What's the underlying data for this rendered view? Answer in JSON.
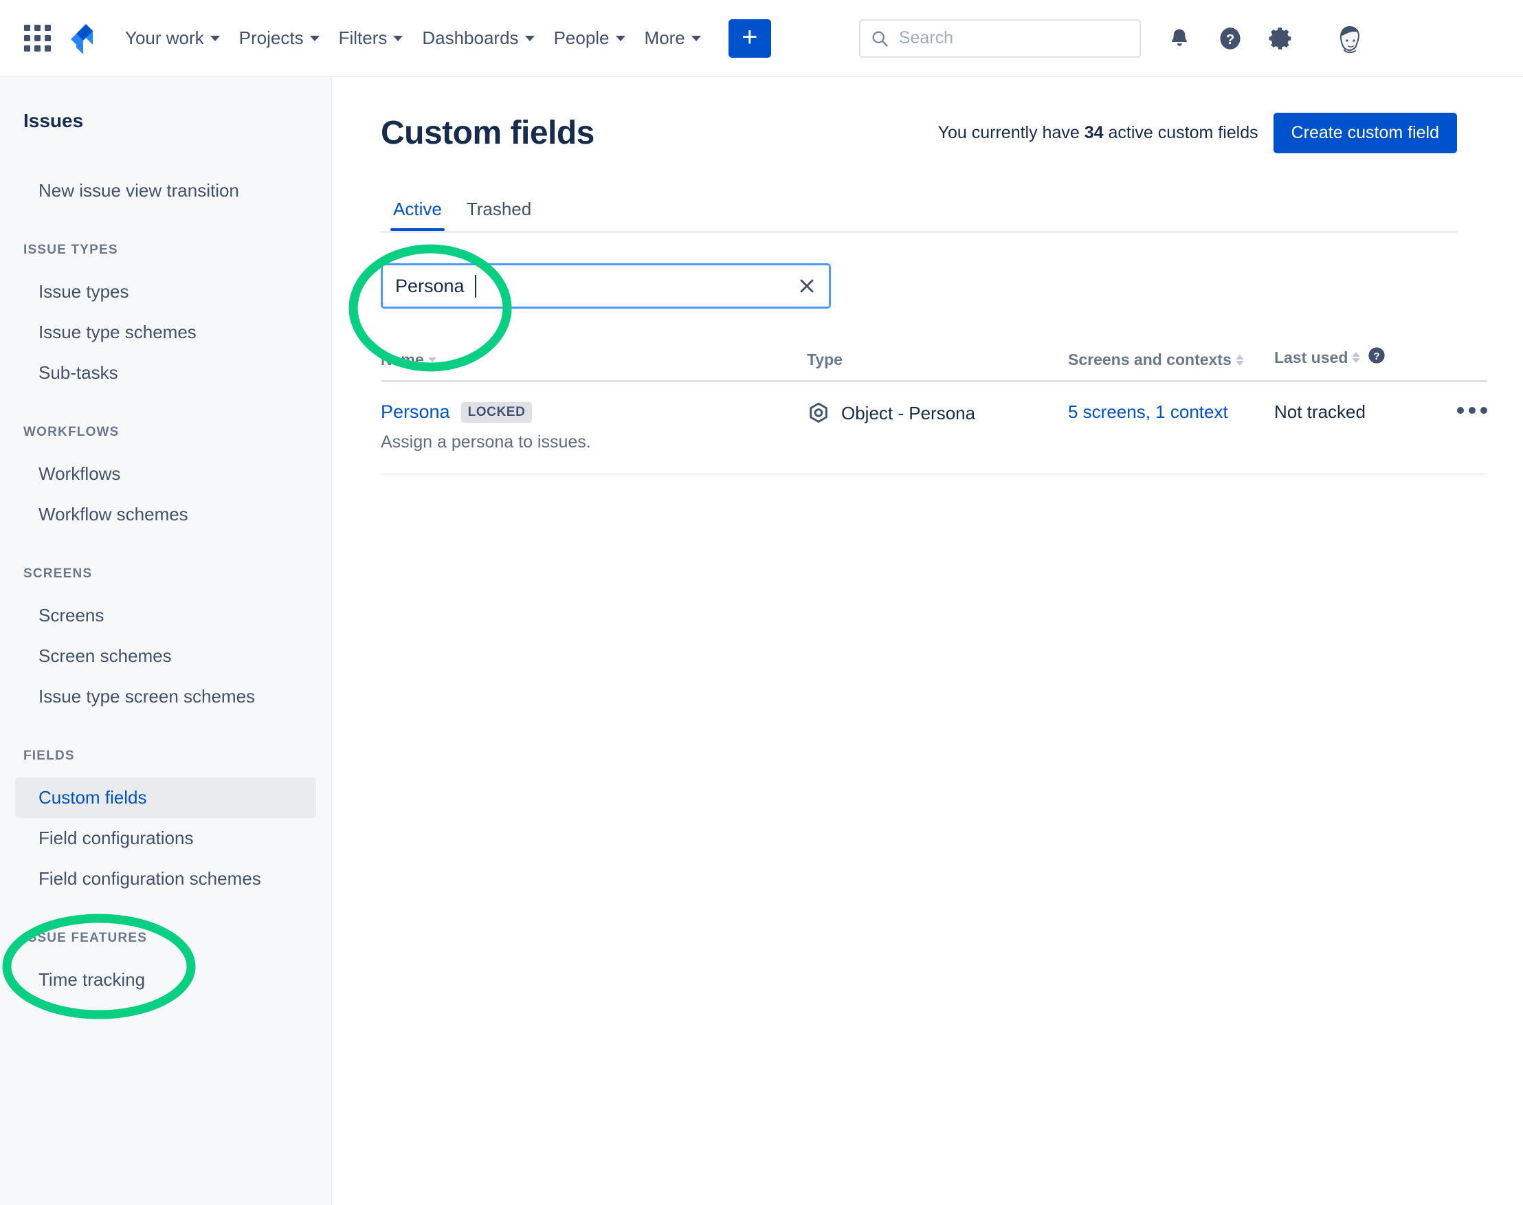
{
  "topnav": {
    "app_switcher_icon": "app-switcher-grid-icon",
    "logo_icon": "jira-logo",
    "items": [
      {
        "label": "Your work",
        "has_caret": true
      },
      {
        "label": "Projects",
        "has_caret": true
      },
      {
        "label": "Filters",
        "has_caret": true
      },
      {
        "label": "Dashboards",
        "has_caret": true
      },
      {
        "label": "People",
        "has_caret": true
      },
      {
        "label": "More",
        "has_caret": true
      }
    ],
    "create_button_label": "+",
    "search_placeholder": "Search",
    "search_value": "",
    "icons": [
      "notifications-bell-icon",
      "help-question-icon",
      "settings-gear-icon",
      "user-avatar"
    ]
  },
  "sidebar": {
    "title": "Issues",
    "groups": [
      {
        "section": null,
        "items": [
          {
            "label": "New issue view transition",
            "selected": false
          }
        ]
      },
      {
        "section": "ISSUE TYPES",
        "items": [
          {
            "label": "Issue types",
            "selected": false
          },
          {
            "label": "Issue type schemes",
            "selected": false
          },
          {
            "label": "Sub-tasks",
            "selected": false
          }
        ]
      },
      {
        "section": "WORKFLOWS",
        "items": [
          {
            "label": "Workflows",
            "selected": false
          },
          {
            "label": "Workflow schemes",
            "selected": false
          }
        ]
      },
      {
        "section": "SCREENS",
        "items": [
          {
            "label": "Screens",
            "selected": false
          },
          {
            "label": "Screen schemes",
            "selected": false
          },
          {
            "label": "Issue type screen schemes",
            "selected": false
          }
        ]
      },
      {
        "section": "FIELDS",
        "items": [
          {
            "label": "Custom fields",
            "selected": true
          },
          {
            "label": "Field configurations",
            "selected": false
          },
          {
            "label": "Field configuration schemes",
            "selected": false
          }
        ]
      },
      {
        "section": "ISSUE FEATURES",
        "items": [
          {
            "label": "Time tracking",
            "selected": false
          }
        ]
      }
    ]
  },
  "main": {
    "page_title": "Custom fields",
    "count_prefix": "You currently have ",
    "count_value": "34",
    "count_suffix": " active custom fields",
    "create_field_button": "Create custom field",
    "tabs": [
      {
        "label": "Active",
        "active": true
      },
      {
        "label": "Trashed",
        "active": false
      }
    ],
    "filter": {
      "value": "Persona",
      "placeholder": "",
      "clear_icon": "close-x-icon"
    },
    "table": {
      "columns": [
        {
          "label": "Name",
          "sortable": true
        },
        {
          "label": "Type",
          "sortable": false
        },
        {
          "label": "Screens and contexts",
          "sortable": true
        },
        {
          "label": "Last used",
          "sortable": true,
          "help": true
        },
        {
          "label": "",
          "sortable": false
        }
      ],
      "rows": [
        {
          "name": "Persona",
          "badge": "LOCKED",
          "description": "Assign a persona to issues.",
          "type_icon": "object-hexagon-icon",
          "type": "Object - Persona",
          "screens_and_contexts": "5 screens, 1 context",
          "last_used": "Not tracked",
          "actions_icon": "more-actions-icon"
        }
      ]
    }
  },
  "annotations": {
    "color": "#0ACF83",
    "marks": [
      {
        "target": "filter-input",
        "shape": "ellipse"
      },
      {
        "target": "sidebar-item-custom-fields",
        "shape": "ellipse"
      }
    ]
  }
}
